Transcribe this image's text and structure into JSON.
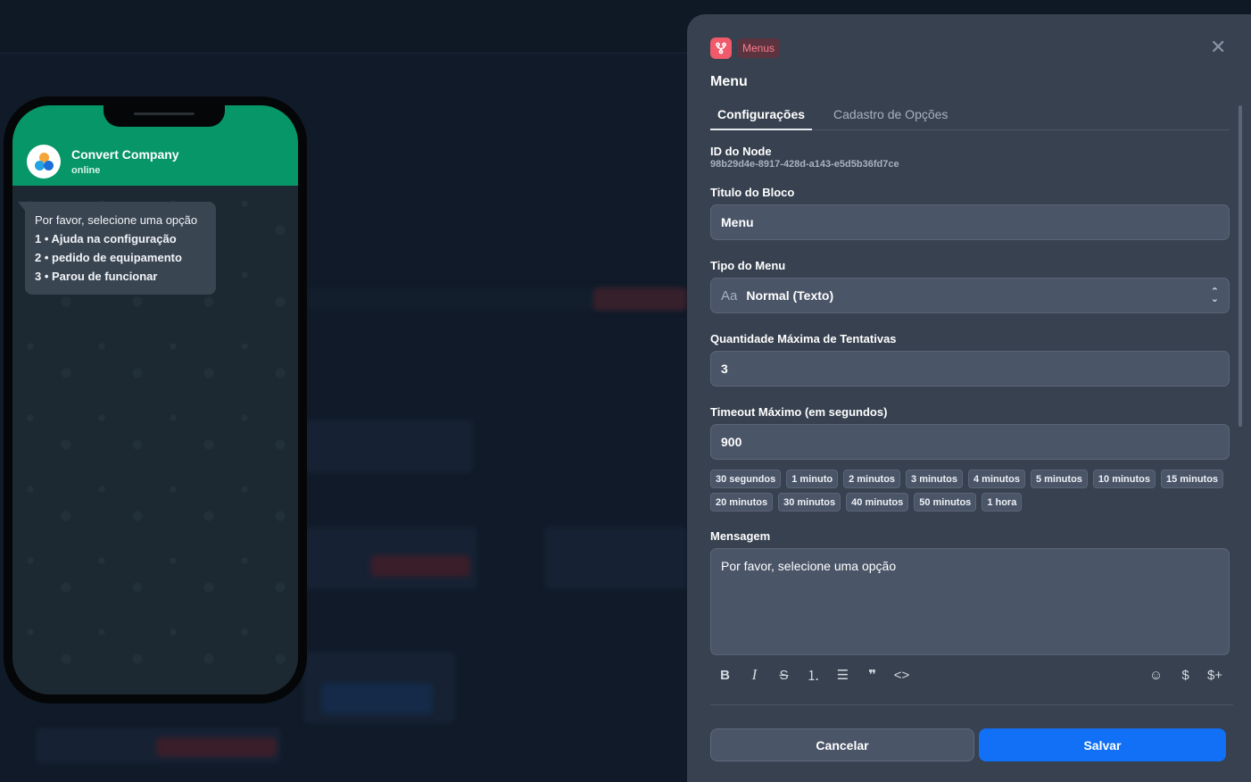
{
  "colors": {
    "whatsapp_green": "#079668",
    "accent_blue": "#1170f5",
    "tag_red": "#f05a6b"
  },
  "phone": {
    "contact_name": "Convert Company",
    "contact_status": "online",
    "message_intro": "Por favor, selecione uma opção",
    "options": [
      {
        "num": "1",
        "label": "Ajuda na configuração"
      },
      {
        "num": "2",
        "label": "pedido de equipamento"
      },
      {
        "num": "3",
        "label": "Parou de funcionar"
      }
    ]
  },
  "panel": {
    "tag_icon": "fork-icon",
    "tag_label": "Menus",
    "title": "Menu",
    "tabs": [
      {
        "label": "Configurações",
        "active": true
      },
      {
        "label": "Cadastro de Opções",
        "active": false
      }
    ],
    "node_id_label": "ID do Node",
    "node_id_value": "98b29d4e-8917-428d-a143-e5d5b36fd7ce",
    "block_title_label": "Titulo do Bloco",
    "block_title_value": "Menu",
    "menu_type_label": "Tipo do Menu",
    "menu_type_prefix": "Aa",
    "menu_type_value": "Normal (Texto)",
    "max_attempts_label": "Quantidade Máxima de Tentativas",
    "max_attempts_value": "3",
    "timeout_label": "Timeout Máximo (em segundos)",
    "timeout_value": "900",
    "timeout_presets": [
      "30 segundos",
      "1 minuto",
      "2 minutos",
      "3 minutos",
      "4 minutos",
      "5 minutos",
      "10 minutos",
      "15 minutos",
      "20 minutos",
      "30 minutos",
      "40 minutos",
      "50 minutos",
      "1 hora"
    ],
    "message_label": "Mensagem",
    "message_value": "Por favor, selecione uma opção",
    "toolbar": {
      "bold": "B",
      "italic": "I",
      "strike": "S",
      "ordered_list": "⒈",
      "bullet_list": "☰",
      "quote": "❞",
      "code": "<>",
      "emoji": "☺",
      "variable": "$",
      "add_variable": "$+"
    },
    "cancel_label": "Cancelar",
    "save_label": "Salvar"
  }
}
